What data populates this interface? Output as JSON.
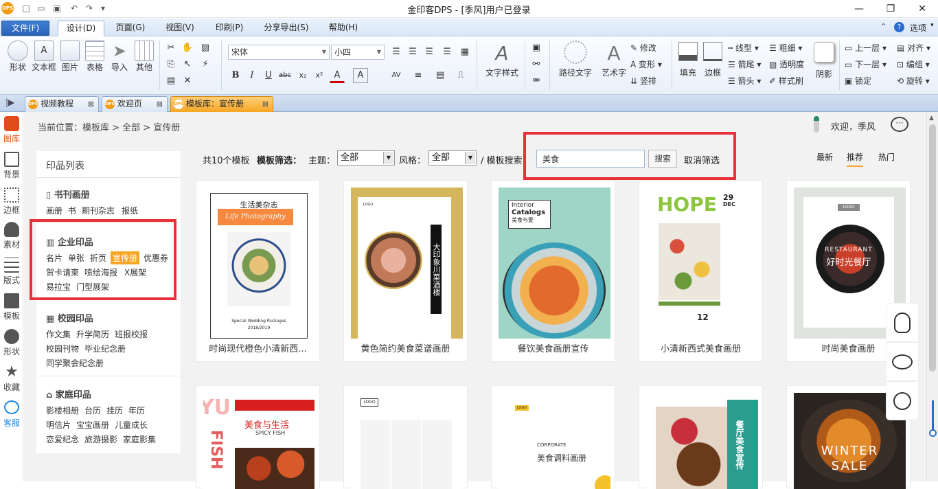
{
  "titlebar": {
    "title": "金印客DPS - [季风]用户已登录",
    "app_logo": "DPS"
  },
  "menu": {
    "file": "文件(F)",
    "tabs": [
      "设计(D)",
      "页面(G)",
      "视图(V)",
      "印刷(P)",
      "分享导出(S)",
      "帮助(H)"
    ],
    "options": "选项"
  },
  "ribbon": {
    "big1": [
      "形状",
      "文本框",
      "图片",
      "表格",
      "导入",
      "其他"
    ],
    "font": "宋体",
    "size": "小四",
    "bold": "B",
    "italic": "I",
    "underline": "U",
    "strike": "abc",
    "sub": "x₂",
    "sup": "x²",
    "color": "A",
    "shade": "A",
    "wordart_style": "文字样式",
    "path_text": "路径文字",
    "art_text": "艺术字",
    "modify": "修改",
    "transform": "变形",
    "vertical": "竖排",
    "fill": "填充",
    "border": "边框",
    "line_type": "线型",
    "thickness": "粗细",
    "arrow_tail": "箭尾",
    "transparency": "透明度",
    "arrow_head": "箭头",
    "style_brush": "样式刷",
    "shadow": "阴影",
    "up_layer": "上一层",
    "align": "对齐",
    "down_layer": "下一层",
    "group": "编组",
    "lock": "锁定",
    "rotate": "旋转"
  },
  "doc_tabs": [
    "视频教程",
    "欢迎页",
    "模板库：宣传册"
  ],
  "leftbar": [
    "图库",
    "背景",
    "边框",
    "素材",
    "版式",
    "模板",
    "形状",
    "收藏",
    "客服"
  ],
  "breadcrumb": "当前位置：模板库 > 全部 > 宣传册",
  "user": {
    "welcome": "欢迎，季风"
  },
  "catalog": {
    "title": "印品列表",
    "groups": [
      {
        "name": "书刊画册",
        "rows": [
          [
            "画册",
            "书",
            "期刊杂志",
            "报纸"
          ]
        ]
      },
      {
        "name": "企业印品",
        "rows": [
          [
            "名片",
            "单张",
            "折页",
            "宣传册",
            "优惠券"
          ],
          [
            "贺卡请柬",
            "喷绘海报",
            "X展架"
          ],
          [
            "易拉宝",
            "门型展架"
          ]
        ]
      },
      {
        "name": "校园印品",
        "rows": [
          [
            "作文集",
            "升学简历",
            "班报校报"
          ],
          [
            "校园刊物",
            "毕业纪念册"
          ],
          [
            "同学聚会纪念册"
          ]
        ]
      },
      {
        "name": "家庭印品",
        "rows": [
          [
            "影楼相册",
            "台历",
            "挂历",
            "年历"
          ],
          [
            "明信片",
            "宝宝画册",
            "儿童成长"
          ],
          [
            "恋爱纪念",
            "旅游摄影",
            "家庭影集"
          ]
        ]
      }
    ]
  },
  "filter": {
    "count": "共10个模板",
    "label": "模板筛选：",
    "theme_label": "主题：",
    "theme_value": "全部",
    "style_label": "风格：",
    "style_value": "全部",
    "search_label": "/ 模板搜索：",
    "search_value": "美食",
    "search_btn": "搜索",
    "cancel": "取消筛选"
  },
  "sort": {
    "latest": "最新",
    "recommend": "推荐",
    "hot": "热门"
  },
  "templates": [
    {
      "caption": "时尚现代橙色小清新西...",
      "t1": "生活美杂志",
      "t2": "Life Photography",
      "t3": "Special Wedding Packages",
      "t4": "2018/2019"
    },
    {
      "caption": "黄色简约美食菜谱画册",
      "t1": "大印象川菜酒楼",
      "t2": "LOGO"
    },
    {
      "caption": "餐饮美食画册宣传",
      "t1": "Interior",
      "t2": "Catalogs",
      "t3": "美食与爱"
    },
    {
      "caption": "小清新西式美食画册",
      "t1": "HOPE",
      "t2": "29",
      "t3": "DEC",
      "t4": "12"
    },
    {
      "caption": "时尚美食画册",
      "t1": "LOGO",
      "t2": "RESTAURANT",
      "t3": "好时光餐厅"
    },
    {
      "t1": "YU",
      "t2": "美食与生活",
      "t3": "SPICY FISH",
      "t4": "FISH"
    },
    {
      "t1": "LOGO"
    },
    {
      "t1": "LOGO",
      "t2": "CORPORATE",
      "t3": "美食调料画册"
    },
    {
      "t1": "餐厅美食宣传"
    },
    {
      "t1": "WINTER",
      "t2": "SALE"
    }
  ]
}
